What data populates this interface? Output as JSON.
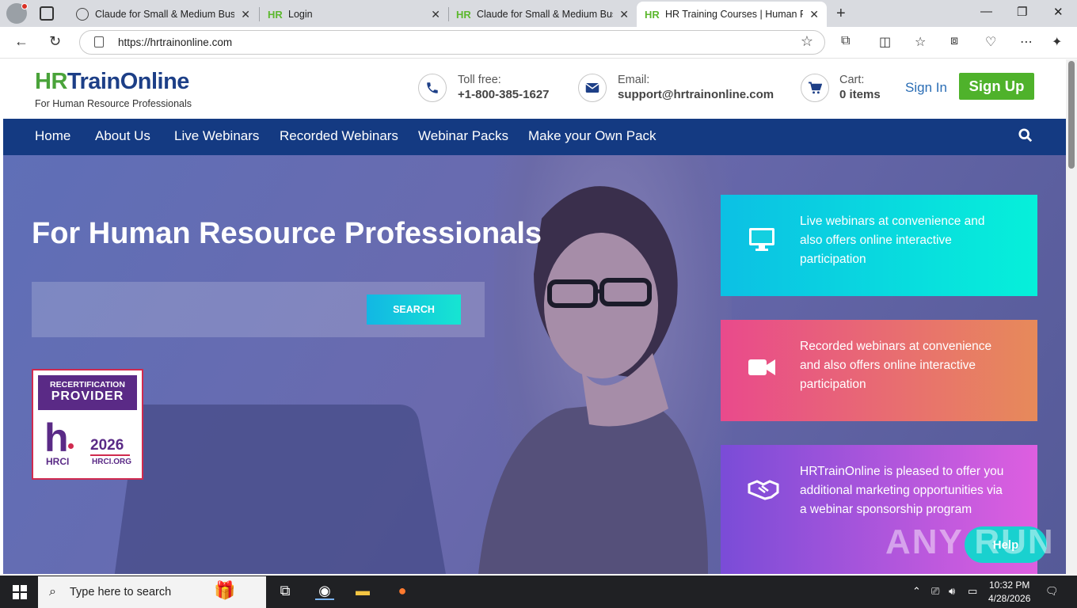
{
  "browser": {
    "tabs": [
      {
        "title": "Claude for Small & Medium Busin",
        "favicon": "globe-icon"
      },
      {
        "title": "Login",
        "favicon": "HR"
      },
      {
        "title": "Claude for Small & Medium Busin",
        "favicon": "HR"
      },
      {
        "title": "HR Training Courses | Human Res",
        "favicon": "HR",
        "active": true
      }
    ],
    "url": "https://hrtrainonline.com"
  },
  "site": {
    "logo_hr": "HR",
    "logo_rest": "TrainOnline",
    "tagline": "For Human Resource Professionals",
    "toll_label": "Toll free:",
    "toll_value": "+1-800-385-1627",
    "email_label": "Email:",
    "email_value": "support@hrtrainonline.com",
    "cart_label": "Cart:",
    "cart_value": "0 items",
    "signin": "Sign In",
    "signup": "Sign Up",
    "nav": [
      "Home",
      "About Us",
      "Live Webinars",
      "Recorded Webinars",
      "Webinar Packs",
      "Make your Own Pack"
    ],
    "hero_title": "For Human Resource Professionals",
    "search_button": "SEARCH",
    "badge": {
      "line1": "RECERTIFICATION",
      "line2": "PROVIDER",
      "brand": "HRCI",
      "year": "2026",
      "site": "HRCI.ORG",
      "letter": "h"
    },
    "cards": [
      "Live webinars at convenience and also offers online interactive participation",
      "Recorded webinars at convenience and also offers online interactive participation",
      "HRTrainOnline is pleased to offer you additional marketing opportunities via a webinar sponsorship program"
    ],
    "help": "Help",
    "watermark": "ANY RUN"
  },
  "taskbar": {
    "search_placeholder": "Type here to search",
    "time": "10:32 PM",
    "date": "4/28/2026"
  },
  "colors": {
    "nav_bg": "#143a82",
    "signup": "#4fb22b",
    "logo_green": "#4aa33a",
    "logo_blue": "#1d3f87"
  }
}
